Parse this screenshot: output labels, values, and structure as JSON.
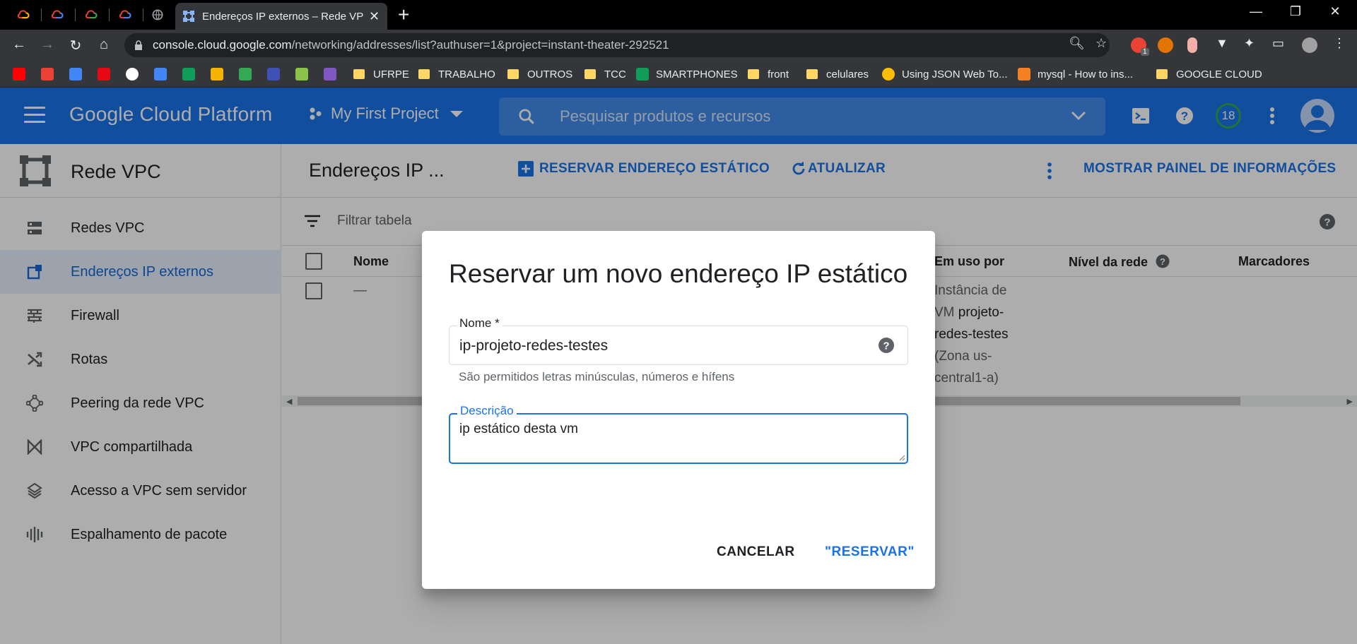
{
  "browser": {
    "tab_title": "Endereços IP externos – Rede VPC",
    "url_host": "console.cloud.google.com",
    "url_path": "/networking/addresses/list?authuser=1&project=instant-theater-292521",
    "ext_badge": "1"
  },
  "bookmarks": [
    {
      "label": "UFRPE"
    },
    {
      "label": "TRABALHO"
    },
    {
      "label": "OUTROS"
    },
    {
      "label": "TCC"
    },
    {
      "label": "SMARTPHONES"
    },
    {
      "label": "front"
    },
    {
      "label": "celulares"
    },
    {
      "label": "Using JSON Web To..."
    },
    {
      "label": "mysql - How to ins..."
    },
    {
      "label": "GOOGLE CLOUD"
    }
  ],
  "header": {
    "logo": "Google Cloud Platform",
    "project": "My First Project",
    "search_placeholder": "Pesquisar produtos e recursos",
    "notification_count": "18"
  },
  "sidebar": {
    "title": "Rede VPC",
    "items": [
      {
        "label": "Redes VPC",
        "icon": "vpc-networks-icon"
      },
      {
        "label": "Endereços IP externos",
        "icon": "external-ip-icon"
      },
      {
        "label": "Firewall",
        "icon": "firewall-icon"
      },
      {
        "label": "Rotas",
        "icon": "routes-icon"
      },
      {
        "label": "Peering da rede VPC",
        "icon": "peering-icon"
      },
      {
        "label": "VPC compartilhada",
        "icon": "shared-vpc-icon"
      },
      {
        "label": "Acesso a VPC sem servidor",
        "icon": "serverless-access-icon"
      },
      {
        "label": "Espalhamento de pacote",
        "icon": "packet-mirroring-icon"
      }
    ]
  },
  "main": {
    "title": "Endereços IP ...",
    "reserve_label": "RESERVAR ENDEREÇO ESTÁTICO",
    "refresh_label": "ATUALIZAR",
    "info_panel_label": "MOSTRAR PAINEL DE INFORMAÇÕES",
    "filter_placeholder": "Filtrar tabela",
    "columns": {
      "name": "Nome",
      "in_use_by": "Em uso por",
      "network_tier": "Nível da rede",
      "labels": "Marcadores"
    },
    "row": {
      "name": "—",
      "in_use_1": "Instância de",
      "in_use_2_pre": "VM ",
      "in_use_2_link": "projeto-",
      "in_use_3": "redes-testes",
      "in_use_4": "(Zona us-",
      "in_use_5": "central1-a)"
    }
  },
  "dialog": {
    "title": "Reservar um novo endereço IP estático",
    "name_label": "Nome *",
    "name_value": "ip-projeto-redes-testes",
    "name_hint": "São permitidos letras minúsculas, números e hífens",
    "desc_label": "Descrição",
    "desc_value": "ip estático desta vm",
    "cancel_label": "CANCELAR",
    "reserve_label": "\"RESERVAR\""
  },
  "colors": {
    "brand_blue": "#1a73e8",
    "active_bg": "#e8f0fe",
    "overlay": "rgba(0,0,0,0.32)"
  }
}
